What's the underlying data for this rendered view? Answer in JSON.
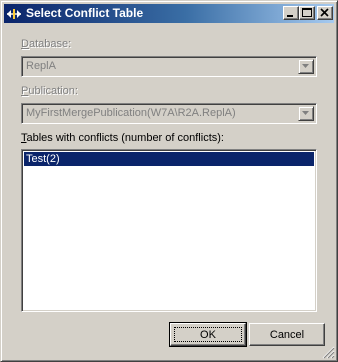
{
  "window": {
    "title": "Select Conflict Table"
  },
  "database": {
    "label_accel": "D",
    "label_rest": "atabase:",
    "value": "ReplA"
  },
  "publication": {
    "label_accel": "P",
    "label_rest": "ublication:",
    "value": "MyFirstMergePublication(W7A\\R2A.ReplA)"
  },
  "tables": {
    "label_accel": "T",
    "label_rest": "ables with conflicts (number of conflicts):",
    "items": [
      "Test(2)"
    ],
    "selected_index": 0
  },
  "buttons": {
    "ok": "OK",
    "cancel": "Cancel"
  },
  "colors": {
    "face": "#d4d0c8",
    "selection": "#0a246a",
    "title_start": "#0a246a",
    "title_end": "#a6caf0"
  }
}
